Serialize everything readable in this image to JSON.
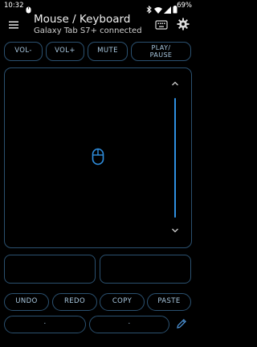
{
  "status_bar": {
    "time": "10:32",
    "battery": "69%"
  },
  "app_bar": {
    "title": "Mouse / Keyboard",
    "subtitle": "Galaxy Tab S7+ connected"
  },
  "media_buttons": [
    "VOL-",
    "VOL+",
    "MUTE",
    "PLAY/\nPAUSE"
  ],
  "edit_buttons": [
    "UNDO",
    "REDO",
    "COPY",
    "PASTE"
  ],
  "bottom_buttons": [
    ".",
    "."
  ],
  "colors": {
    "accent": "#2f8fe0",
    "border": "#2b5170",
    "text": "#a9c8e0",
    "background": "#000000"
  }
}
